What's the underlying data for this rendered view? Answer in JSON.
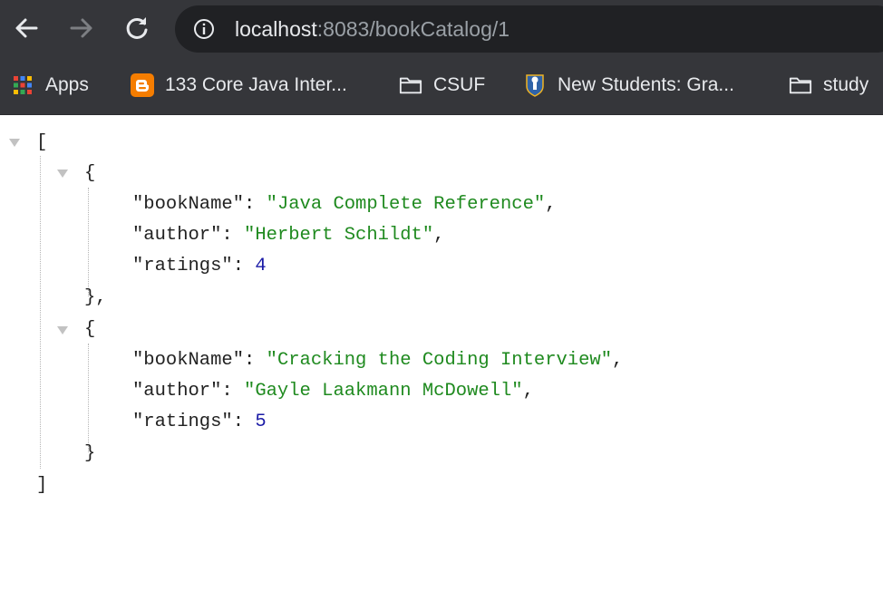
{
  "browser": {
    "url_host": "localhost",
    "url_rest": ":8083/bookCatalog/1",
    "icons": {
      "back": "arrow-left-icon",
      "forward": "arrow-right-icon",
      "reload": "reload-icon",
      "info": "info-circle-icon"
    }
  },
  "bookmarks": [
    {
      "label": "Apps",
      "icon": "apps-grid-icon"
    },
    {
      "label": "133 Core Java Inter...",
      "icon": "blogger-icon"
    },
    {
      "label": "CSUF",
      "icon": "folder-icon"
    },
    {
      "label": "New Students: Gra...",
      "icon": "university-seal-icon"
    },
    {
      "label": "study",
      "icon": "folder-icon"
    }
  ],
  "json": {
    "open_array": "[",
    "close_array": "]",
    "open_object": "{",
    "close_object_comma": "},",
    "close_object": "}",
    "key_bookName": "\"bookName\"",
    "key_author": "\"author\"",
    "key_ratings": "\"ratings\"",
    "colon": ": ",
    "comma": ",",
    "books": [
      {
        "bookName": "\"Java Complete Reference\"",
        "author": "\"Herbert Schildt\"",
        "ratings": "4"
      },
      {
        "bookName": "\"Cracking the Coding Interview\"",
        "author": "\"Gayle Laakmann McDowell\"",
        "ratings": "5"
      }
    ]
  },
  "colors": {
    "toolbar": "#35363a",
    "omnibox": "#202124",
    "string": "#1f8a1f",
    "number": "#1a1aa6"
  }
}
